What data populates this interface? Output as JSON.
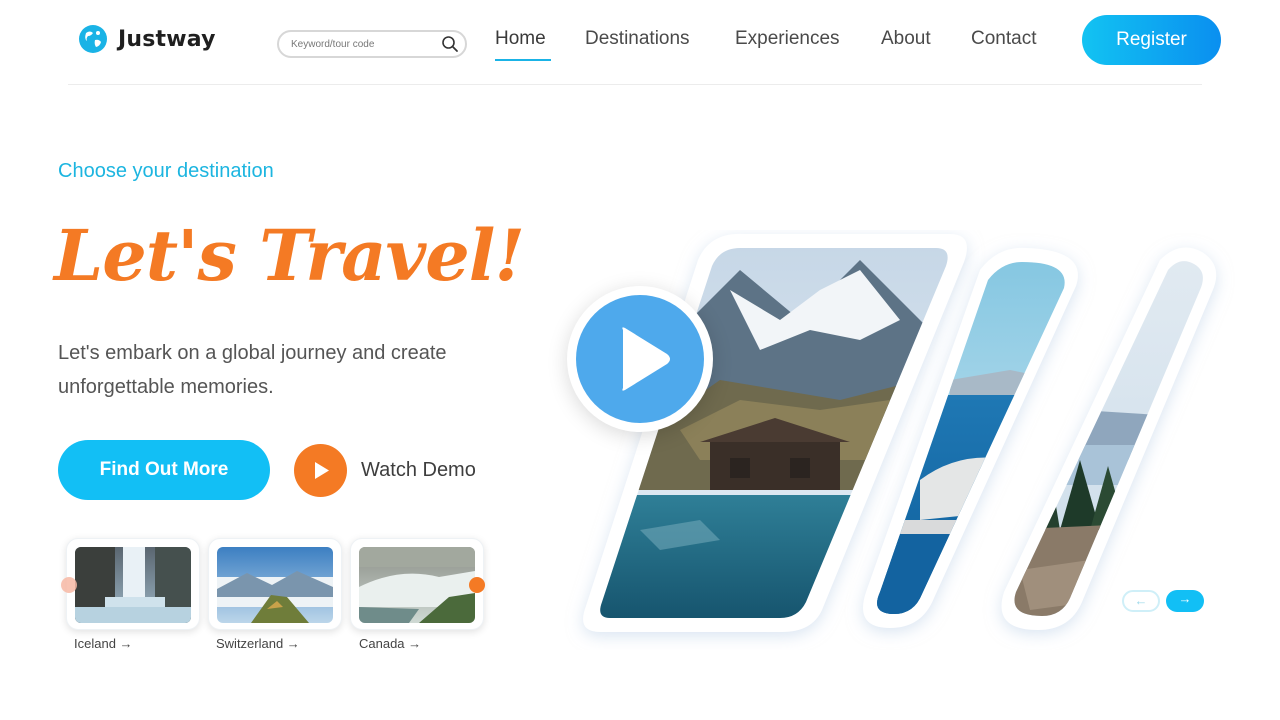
{
  "header": {
    "brand": "Justway",
    "search": {
      "placeholder": "Keyword/tour code",
      "value": ""
    },
    "nav": [
      {
        "label": "Home",
        "active": true
      },
      {
        "label": "Destinations",
        "active": false
      },
      {
        "label": "Experiences",
        "active": false
      },
      {
        "label": "About",
        "active": false
      },
      {
        "label": "Contact",
        "active": false
      }
    ],
    "register_label": "Register"
  },
  "hero": {
    "tagline": "Choose your destination",
    "title": "Let's Travel!",
    "description": "Let's embark on a global journey and create unforgettable memories.",
    "find_out_label": "Find Out More",
    "watch_demo_label": "Watch Demo"
  },
  "destinations": [
    {
      "label": "Iceland →",
      "icon": "waterfall-photo"
    },
    {
      "label": "Switzerland →",
      "icon": "mountain-photo"
    },
    {
      "label": "Canada →",
      "icon": "falls-photo"
    }
  ],
  "slider": {
    "prev_label": "←",
    "next_label": "→"
  },
  "colors": {
    "accent": "#12bff5",
    "brand_orange": "#f47a24",
    "tagline": "#1cb5e0",
    "play_blue": "#4ea9ec"
  }
}
